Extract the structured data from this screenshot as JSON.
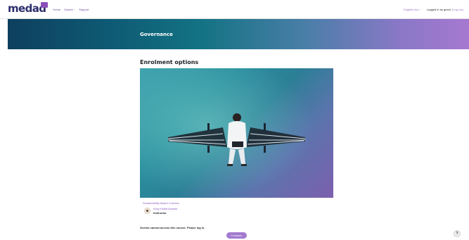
{
  "navbar": {
    "logo_text": "medad",
    "links": [
      {
        "label": "Home"
      },
      {
        "label": "Guides",
        "caret": "⌄"
      },
      {
        "label": "Support"
      }
    ],
    "language": {
      "label": "English (en)",
      "caret": "⌄"
    },
    "login_text": "Logged in as guest.",
    "logout_label": "(Log out)"
  },
  "banner": {
    "title": "Governance"
  },
  "main": {
    "heading": "Enrolment options",
    "course_category": "Sustainability Award Courses",
    "teacher": {
      "name": "King Khalid Awards",
      "role": "Instructor"
    },
    "guest_message": "Guests cannot access this course. Please log in.",
    "continue_label": "Continue"
  },
  "help": {
    "label": "?"
  },
  "colors": {
    "accent": "#a37ad0",
    "link": "#8e5cc2",
    "banner_start": "#0e3f5e",
    "banner_end": "#a679d0"
  }
}
